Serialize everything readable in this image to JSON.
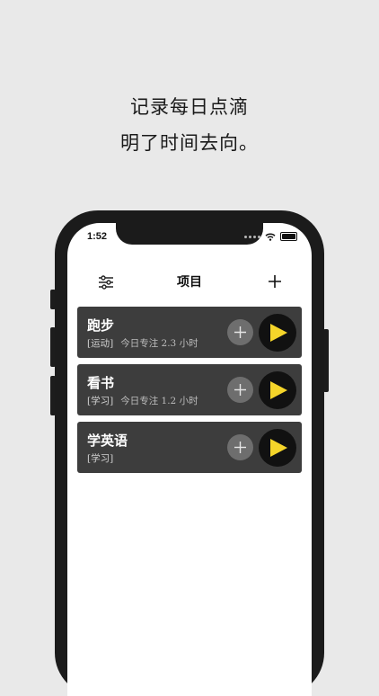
{
  "promo": {
    "line1": "记录每日点滴",
    "line2": "明了时间去向。"
  },
  "status_bar": {
    "time": "1:52"
  },
  "header": {
    "title": "项目",
    "left_icon": "sliders-icon",
    "right_icon": "plus-icon"
  },
  "projects": [
    {
      "name": "跑步",
      "tag": "[运动]",
      "focus": "今日专注 2.3 小时"
    },
    {
      "name": "看书",
      "tag": "[学习]",
      "focus": "今日专注 1.2 小时"
    },
    {
      "name": "学英语",
      "tag": "[学习]",
      "focus": ""
    }
  ],
  "colors": {
    "card_bg": "#3d3d3d",
    "play_accent": "#f5d52a",
    "play_bg": "#111111",
    "add_bg": "#6e6e6e"
  }
}
